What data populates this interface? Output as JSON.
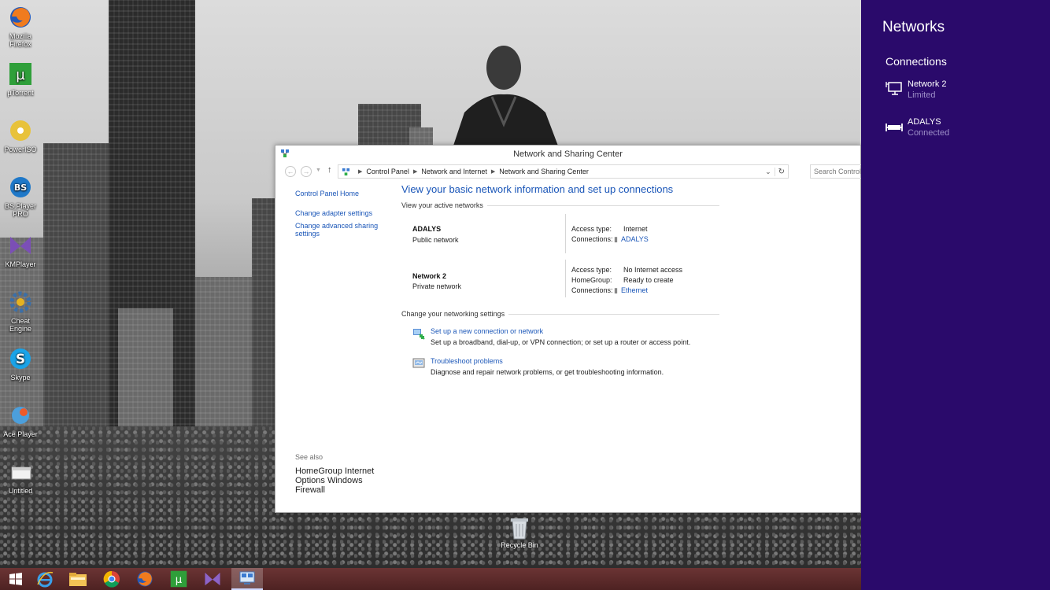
{
  "desktop": {
    "icons": [
      {
        "label": "Mozilla Firefox",
        "icon": "firefox-icon"
      },
      {
        "label": "µTorrent",
        "icon": "utorrent-icon"
      },
      {
        "label": "PowerISO",
        "icon": "poweriso-icon"
      },
      {
        "label": "BS.Player PRO",
        "icon": "bsplayer-icon"
      },
      {
        "label": "KMPlayer",
        "icon": "kmplayer-icon"
      },
      {
        "label": "Cheat Engine",
        "icon": "cheat-engine-icon"
      },
      {
        "label": "Skype",
        "icon": "skype-icon"
      },
      {
        "label": "Ace Player",
        "icon": "ace-player-icon"
      },
      {
        "label": "Untitled",
        "icon": "untitled-file-icon"
      }
    ],
    "recycle_bin": "Recycle Bin"
  },
  "window": {
    "title": "Network and Sharing Center",
    "breadcrumbs": [
      "Control Panel",
      "Network and Internet",
      "Network and Sharing Center"
    ],
    "search_placeholder": "Search Control Panel",
    "left_pane": {
      "home": "Control Panel Home",
      "links": [
        "Change adapter settings",
        "Change advanced sharing settings"
      ],
      "see_also_header": "See also",
      "see_also": [
        "HomeGroup",
        "Internet Options",
        "Windows Firewall"
      ]
    },
    "main": {
      "heading": "View your basic network information and set up connections",
      "active_networks_header": "View your active networks",
      "networks": [
        {
          "name": "ADALYS",
          "type": "Public network",
          "access_label": "Access type:",
          "access_value": "Internet",
          "connections_label": "Connections:",
          "connections_value": "ADALYS"
        },
        {
          "name": "Network  2",
          "type": "Private network",
          "access_label": "Access type:",
          "access_value": "No Internet access",
          "homegroup_label": "HomeGroup:",
          "homegroup_value": "Ready to create",
          "connections_label": "Connections:",
          "connections_value": "Ethernet"
        }
      ],
      "change_settings_header": "Change your networking settings",
      "tasks": [
        {
          "link": "Set up a new connection or network",
          "desc": "Set up a broadband, dial-up, or VPN connection; or set up a router or access point."
        },
        {
          "link": "Troubleshoot problems",
          "desc": "Diagnose and repair network problems, or get troubleshooting information."
        }
      ]
    }
  },
  "charm": {
    "title": "Networks",
    "subtitle": "Connections",
    "connections": [
      {
        "name": "Network  2",
        "status": "Limited",
        "icon": "wired-network-icon"
      },
      {
        "name": "ADALYS",
        "status": "Connected",
        "icon": "cellular-network-icon"
      }
    ],
    "color": "#2a0a6b"
  },
  "taskbar": {
    "items": [
      "start-button",
      "internet-explorer-icon",
      "file-explorer-icon",
      "chrome-icon",
      "firefox-icon",
      "utorrent-icon",
      "kmplayer-icon",
      "network-center-icon"
    ]
  }
}
